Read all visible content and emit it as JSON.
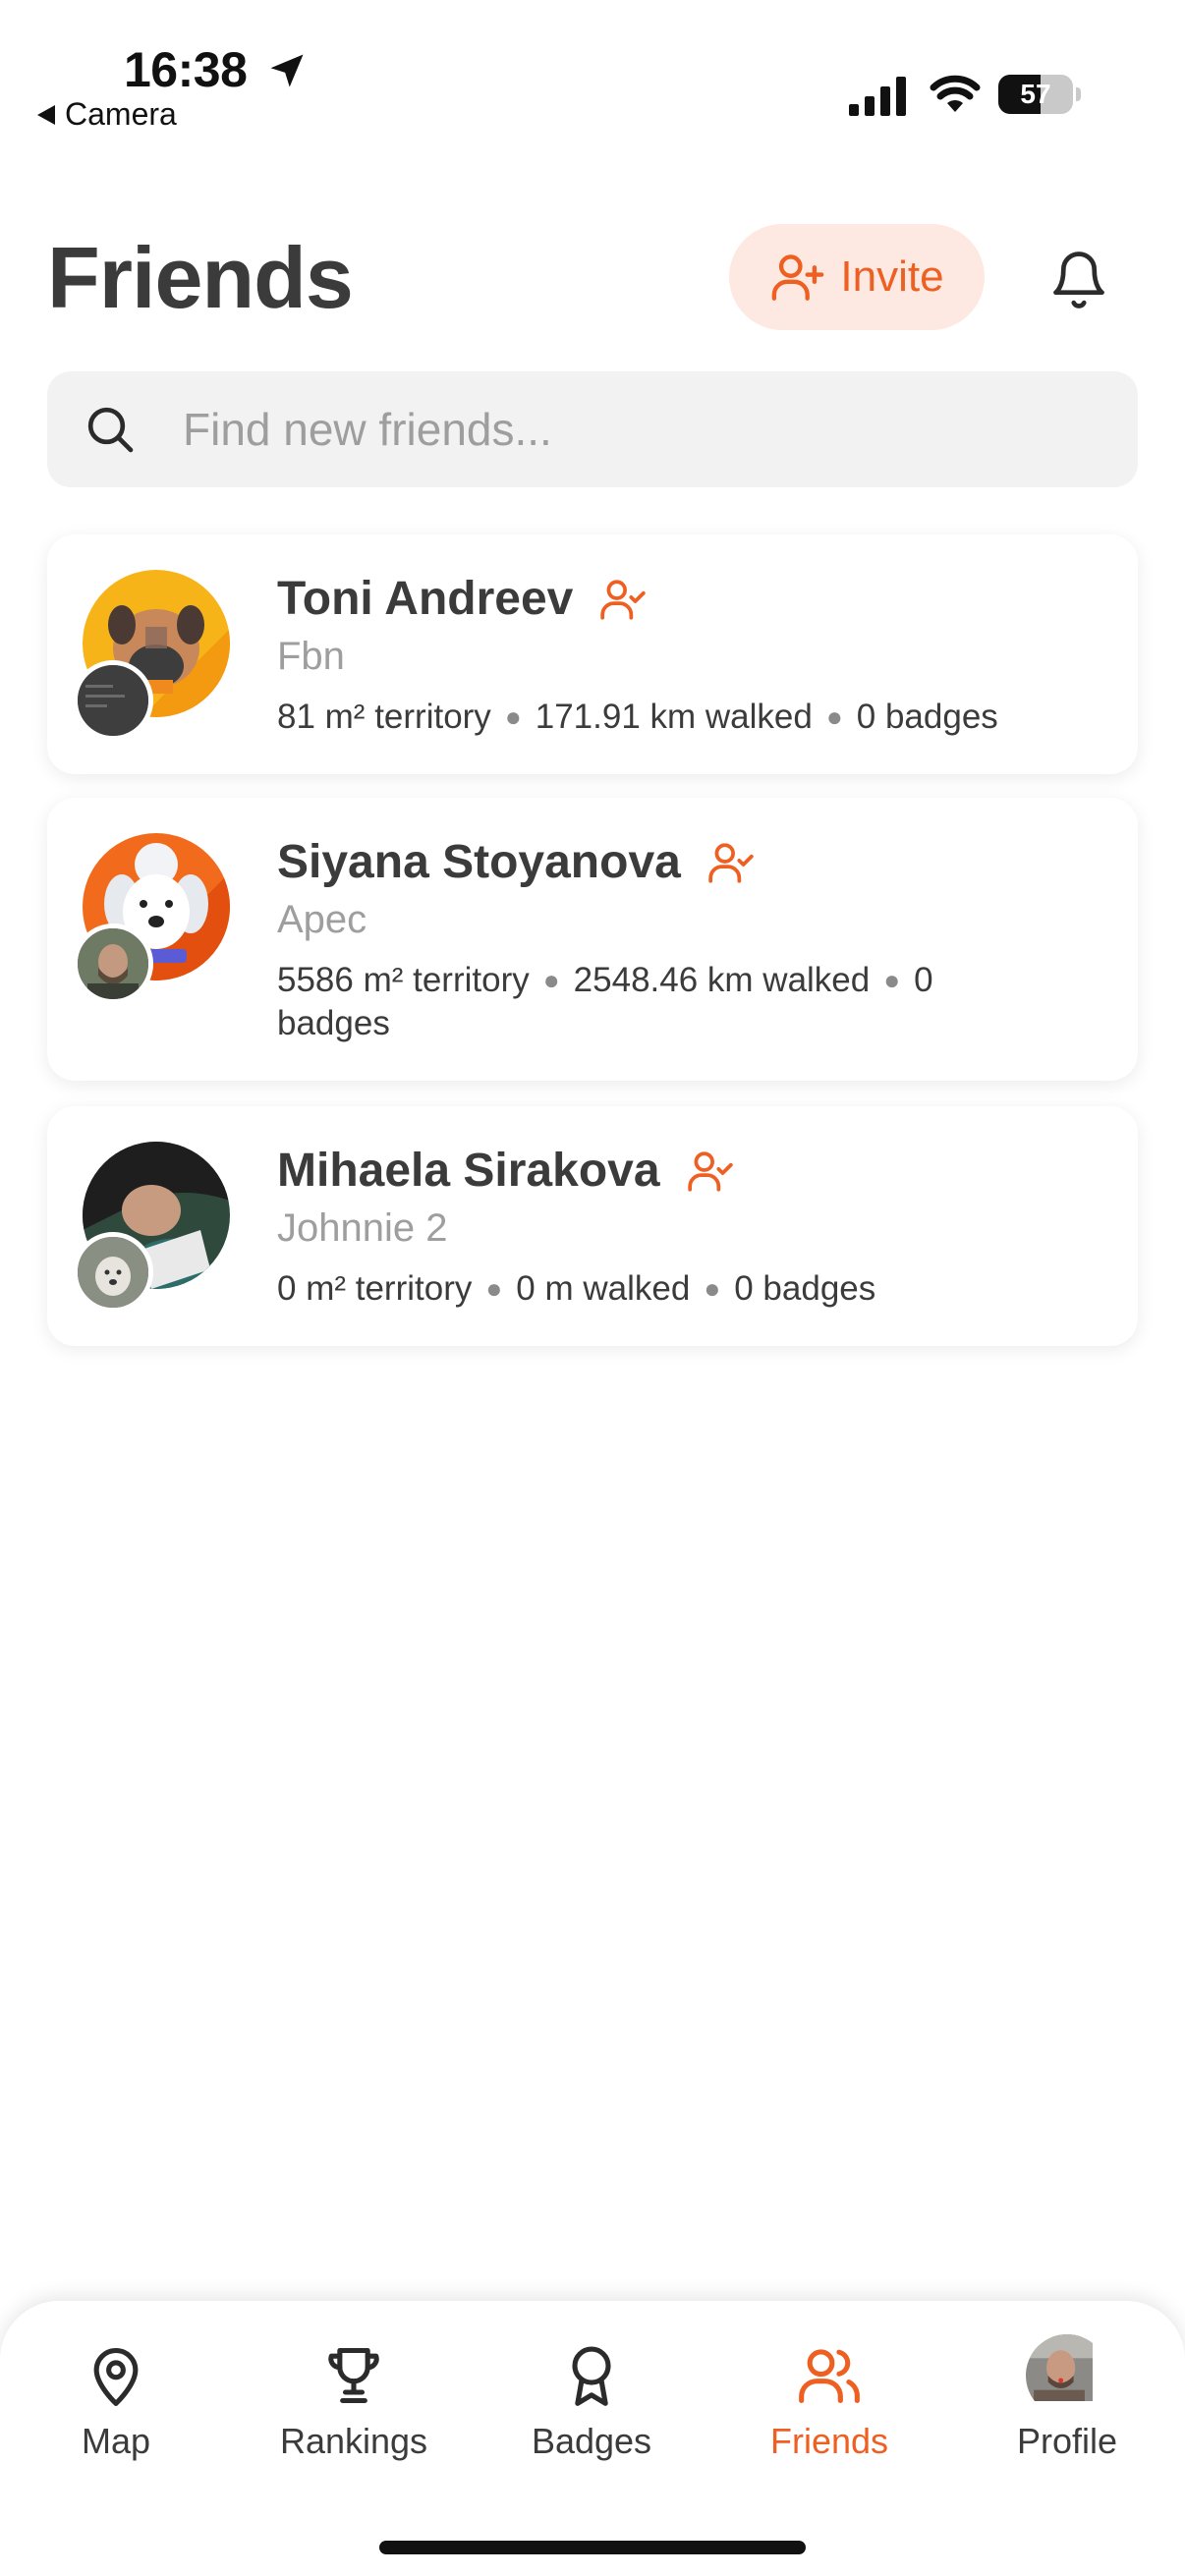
{
  "status_bar": {
    "time": "16:38",
    "back_label": "Camera",
    "battery_percent": 57
  },
  "header": {
    "title": "Friends",
    "invite_label": "Invite"
  },
  "search": {
    "placeholder": "Find new friends..."
  },
  "friends": [
    {
      "name": "Toni Andreev",
      "pet": "Fbn",
      "territory": "81 m² territory",
      "walked": "171.91 km walked",
      "badges": "0 badges"
    },
    {
      "name": "Siyana Stoyanova",
      "pet": "Apec",
      "territory": "5586 m² territory",
      "walked": "2548.46 km walked",
      "badges": "0 badges"
    },
    {
      "name": "Mihaela Sirakova",
      "pet": "Johnnie 2",
      "territory": "0 m² territory",
      "walked": "0 m walked",
      "badges": "0 badges"
    }
  ],
  "tab_bar": {
    "items": [
      {
        "label": "Map",
        "icon": "map-pin-icon"
      },
      {
        "label": "Rankings",
        "icon": "trophy-icon"
      },
      {
        "label": "Badges",
        "icon": "badge-ribbon-icon"
      },
      {
        "label": "Friends",
        "icon": "users-icon"
      },
      {
        "label": "Profile",
        "icon": "profile-avatar"
      }
    ],
    "active": "Friends"
  },
  "colors": {
    "accent": "#ee5f22",
    "accent_soft": "#fde9e1",
    "text": "#3b3b3b",
    "muted": "#9e9e9e",
    "search_bg": "#f2f2f2"
  }
}
